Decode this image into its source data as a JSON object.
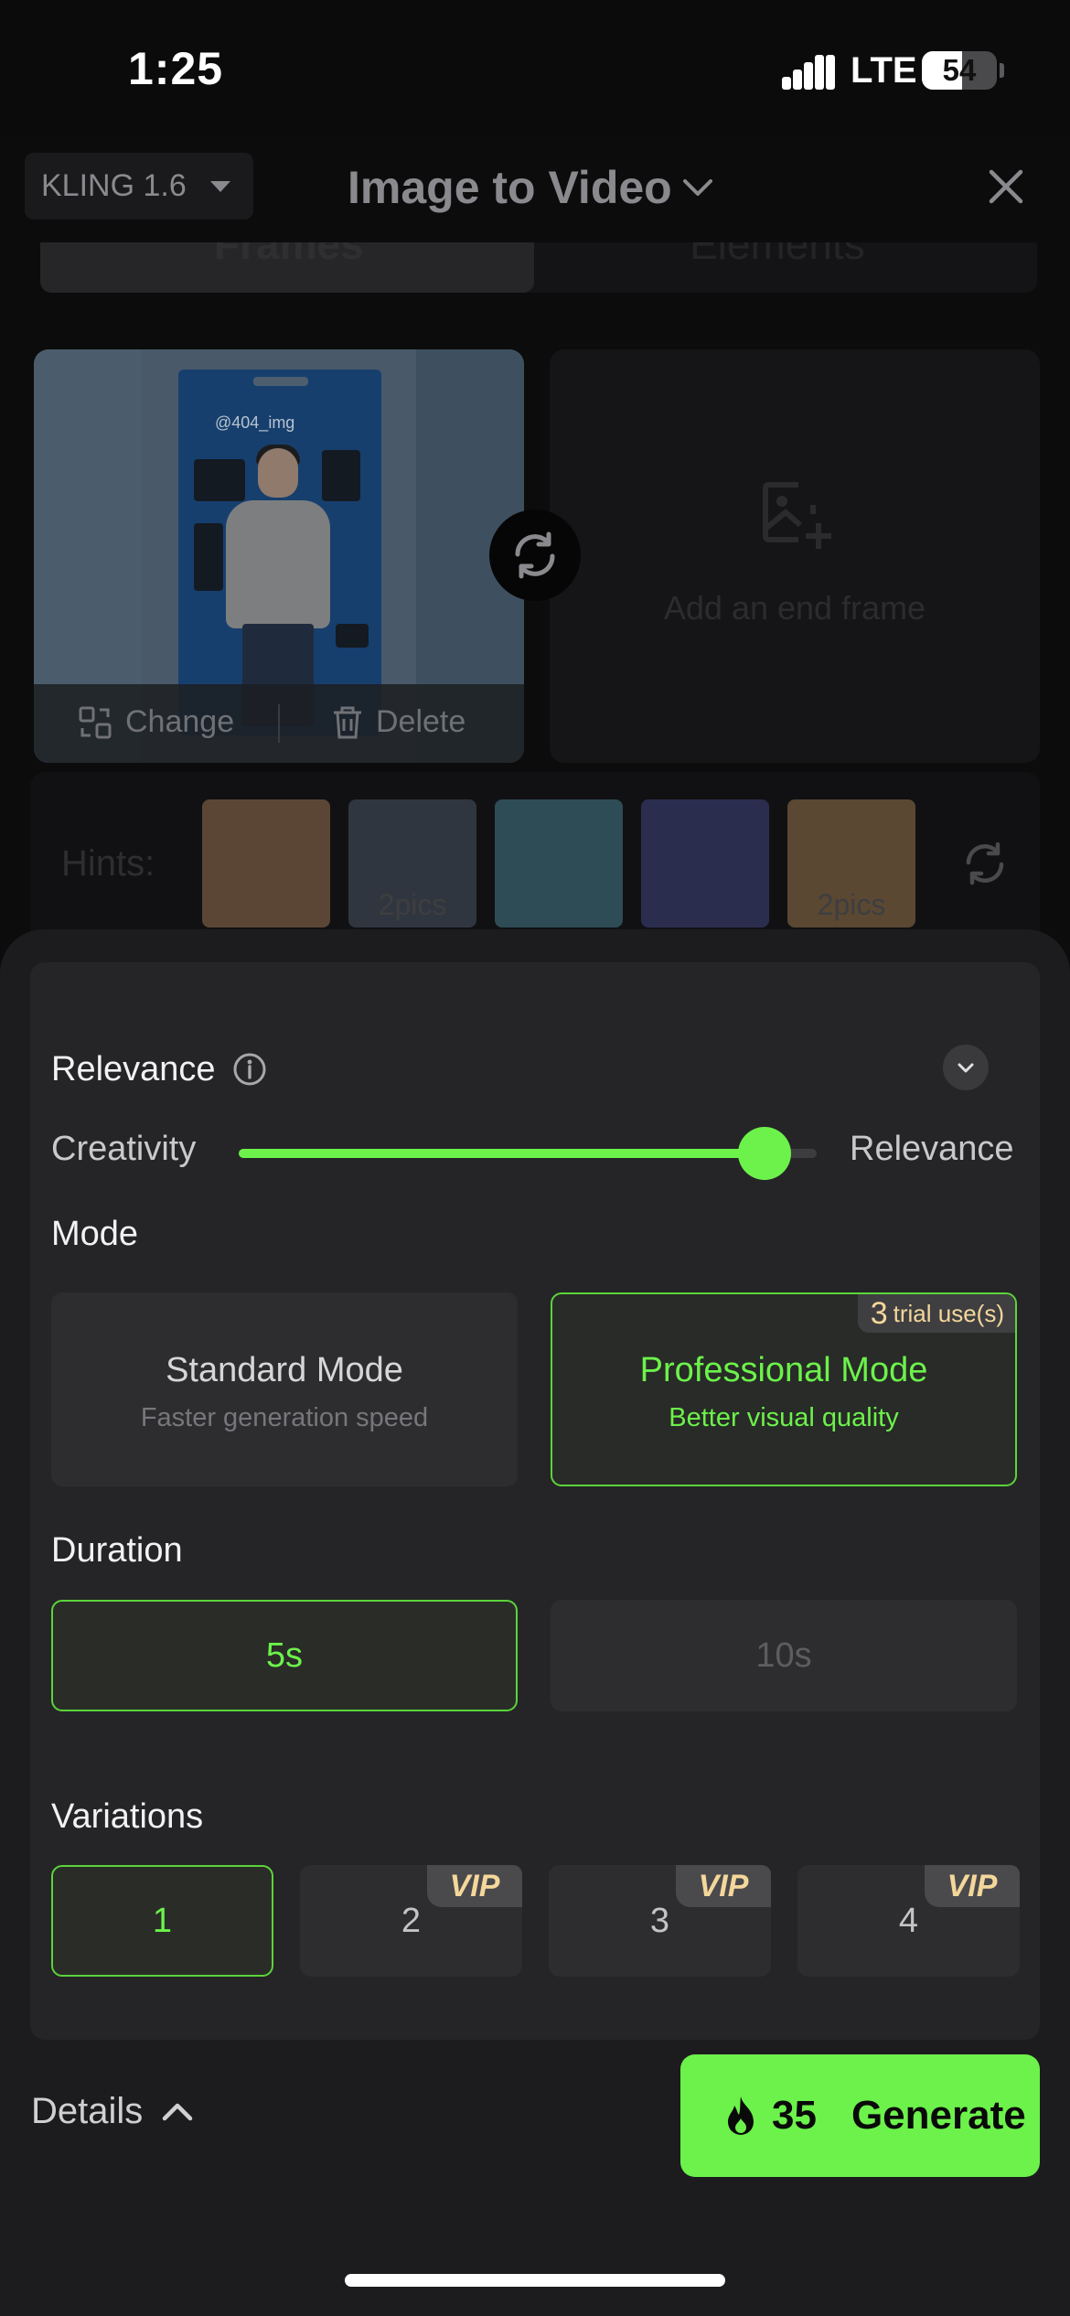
{
  "status_bar": {
    "time": "1:25",
    "network": "LTE",
    "battery": "54",
    "battery_level": 0.54
  },
  "header": {
    "model": "KLING 1.6",
    "title": "Image to Video"
  },
  "tabs": [
    {
      "label": "Frames"
    },
    {
      "label": "Elements"
    }
  ],
  "start_frame": {
    "watermark": "@404_img",
    "change_label": "Change",
    "delete_label": "Delete"
  },
  "end_frame": {
    "placeholder": "Add an end frame"
  },
  "hints": {
    "label": "Hints:",
    "thumbs": [
      {
        "caption": "",
        "color": "#5b4636"
      },
      {
        "caption": "2pics",
        "color": "#30363f"
      },
      {
        "caption": "",
        "color": "#2e4c55"
      },
      {
        "caption": "",
        "color": "#2b2d4f"
      },
      {
        "caption": "2pics",
        "color": "#5a4833"
      }
    ]
  },
  "relevance": {
    "label": "Relevance",
    "slider_left": "Creativity",
    "slider_right": "Relevance",
    "value": 0.91
  },
  "mode": {
    "label": "Mode",
    "options": [
      {
        "title": "Standard Mode",
        "subtitle": "Faster generation speed",
        "selected": false
      },
      {
        "title": "Professional Mode",
        "subtitle": "Better visual quality",
        "selected": true,
        "badge_count": "3",
        "badge_text": "trial use(s)"
      }
    ]
  },
  "duration": {
    "label": "Duration",
    "options": [
      {
        "label": "5s",
        "selected": true
      },
      {
        "label": "10s",
        "selected": false
      }
    ]
  },
  "variations": {
    "label": "Variations",
    "options": [
      {
        "label": "1",
        "selected": true,
        "badge": ""
      },
      {
        "label": "2",
        "selected": false,
        "badge": "VIP"
      },
      {
        "label": "3",
        "selected": false,
        "badge": "VIP"
      },
      {
        "label": "4",
        "selected": false,
        "badge": "VIP"
      }
    ]
  },
  "footer": {
    "details_label": "Details",
    "cost": "35",
    "generate_label": "Generate"
  },
  "colors": {
    "accent": "#6cf24b",
    "vip": "#f4d79a"
  }
}
